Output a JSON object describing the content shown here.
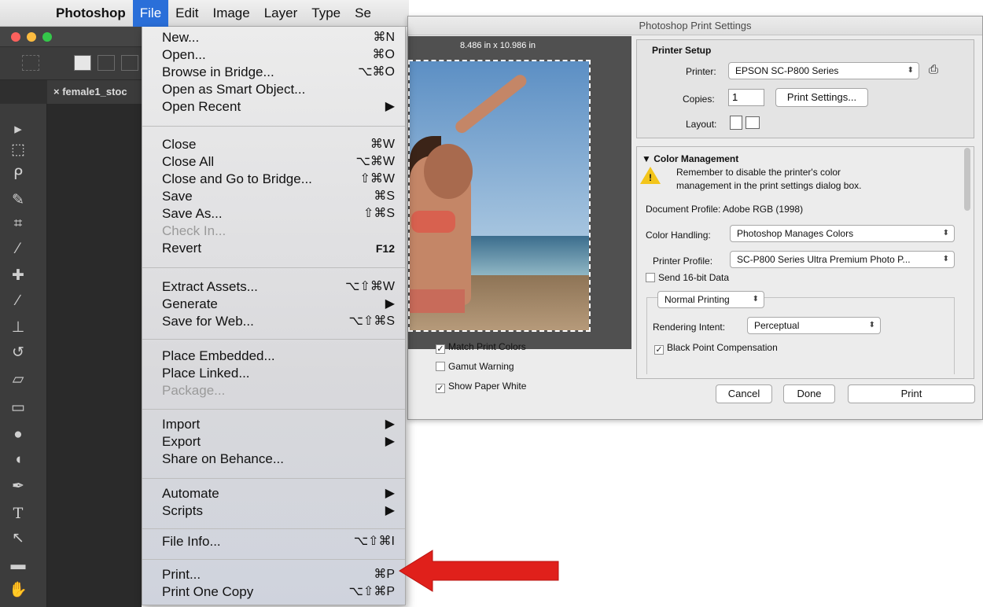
{
  "menubar": {
    "apple_icon": "apple-icon",
    "items": [
      "Photoshop",
      "File",
      "Edit",
      "Image",
      "Layer",
      "Type",
      "Se"
    ]
  },
  "document": {
    "tab_close": "×",
    "tab_name": "female1_stoc"
  },
  "tools": [
    "move-tool-icon",
    "marquee-tool-icon",
    "lasso-tool-icon",
    "quick-select-icon",
    "crop-tool-icon",
    "eyedropper-icon",
    "healing-brush-icon",
    "brush-tool-icon",
    "stamp-tool-icon",
    "history-brush-icon",
    "eraser-icon",
    "gradient-icon",
    "blur-icon",
    "dodge-icon",
    "pen-tool-icon",
    "type-tool-icon",
    "path-select-icon",
    "rectangle-tool-icon",
    "hand-tool-icon"
  ],
  "tool_glyphs": {
    "type": "T"
  },
  "file_menu": {
    "new": {
      "label": "New...",
      "shortcut": "⌘N"
    },
    "open": {
      "label": "Open...",
      "shortcut": "⌘O"
    },
    "browse": {
      "label": "Browse in Bridge...",
      "shortcut": "⌥⌘O"
    },
    "smart": {
      "label": "Open as Smart Object..."
    },
    "recent": {
      "label": "Open Recent",
      "shortcut": "▶"
    },
    "close": {
      "label": "Close",
      "shortcut": "⌘W"
    },
    "close_all": {
      "label": "Close All",
      "shortcut": "⌥⌘W"
    },
    "close_bridge": {
      "label": "Close and Go to Bridge...",
      "shortcut": "⇧⌘W"
    },
    "save": {
      "label": "Save",
      "shortcut": "⌘S"
    },
    "save_as": {
      "label": "Save As...",
      "shortcut": "⇧⌘S"
    },
    "check_in": {
      "label": "Check In..."
    },
    "revert": {
      "label": "Revert",
      "shortcut": "F12"
    },
    "extract": {
      "label": "Extract Assets...",
      "shortcut": "⌥⇧⌘W"
    },
    "generate": {
      "label": "Generate",
      "shortcut": "▶"
    },
    "save_web": {
      "label": "Save for Web...",
      "shortcut": "⌥⇧⌘S"
    },
    "place_embedded": {
      "label": "Place Embedded..."
    },
    "place_linked": {
      "label": "Place Linked..."
    },
    "package": {
      "label": "Package..."
    },
    "import": {
      "label": "Import",
      "shortcut": "▶"
    },
    "export": {
      "label": "Export",
      "shortcut": "▶"
    },
    "behance": {
      "label": "Share on Behance..."
    },
    "automate": {
      "label": "Automate",
      "shortcut": "▶"
    },
    "scripts": {
      "label": "Scripts",
      "shortcut": "▶"
    },
    "file_info": {
      "label": "File Info...",
      "shortcut": "⌥⇧⌘I"
    },
    "print": {
      "label": "Print...",
      "shortcut": "⌘P"
    },
    "print_one": {
      "label": "Print One Copy",
      "shortcut": "⌥⇧⌘P"
    }
  },
  "print_dialog": {
    "title": "Photoshop Print Settings",
    "paper_size": "8.486 in x 10.986 in",
    "match_print_colors": {
      "label": "Match Print Colors",
      "checked": true
    },
    "gamut_warning": {
      "label": "Gamut Warning",
      "checked": false
    },
    "show_paper_white": {
      "label": "Show Paper White",
      "checked": true
    },
    "printer_setup": {
      "heading": "Printer Setup",
      "printer_label": "Printer:",
      "printer_value": "EPSON SC-P800 Series",
      "copies_label": "Copies:",
      "copies_value": "1",
      "print_settings_button": "Print Settings...",
      "layout_label": "Layout:"
    },
    "color_management": {
      "heading": "Color Management",
      "disclosure": "▼",
      "warning_line1": "Remember to disable the printer's color",
      "warning_line2": "management in the print settings dialog box.",
      "document_profile": "Document Profile: Adobe RGB (1998)",
      "color_handling_label": "Color Handling:",
      "color_handling_value": "Photoshop Manages Colors",
      "printer_profile_label": "Printer Profile:",
      "printer_profile_value": "SC-P800 Series Ultra Premium Photo P...",
      "send16": {
        "label": "Send 16-bit Data",
        "checked": false
      },
      "normal_printing": "Normal Printing",
      "rendering_intent_label": "Rendering Intent:",
      "rendering_intent_value": "Perceptual",
      "black_point": {
        "label": "Black Point Compensation",
        "checked": true
      }
    },
    "buttons": {
      "cancel": "Cancel",
      "done": "Done",
      "print": "Print"
    }
  },
  "colors": {
    "menu_highlight": "#2a6fd9",
    "arrow": "#e0201b"
  }
}
